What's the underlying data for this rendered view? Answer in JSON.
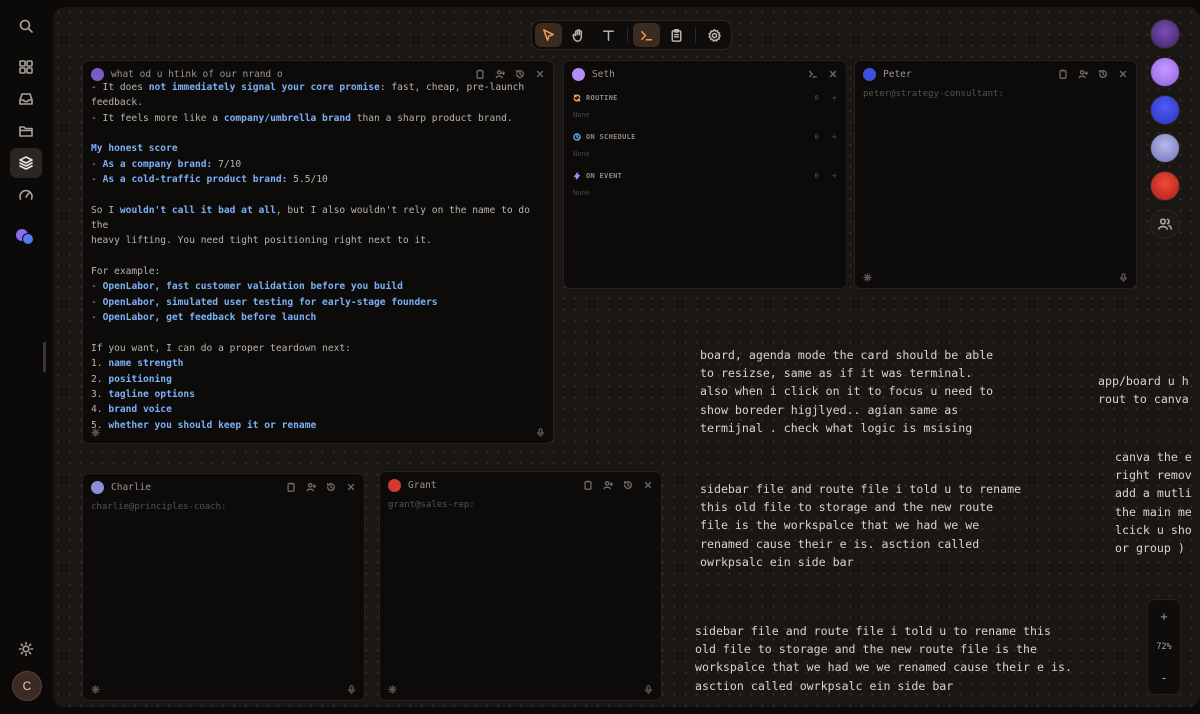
{
  "sidebar": {
    "items": [
      {
        "name": "search",
        "icon": "search-icon"
      },
      {
        "name": "dashboard",
        "icon": "grid-icon"
      },
      {
        "name": "inbox",
        "icon": "inbox-icon"
      },
      {
        "name": "folder",
        "icon": "folder-icon"
      },
      {
        "name": "layers",
        "icon": "layers-icon",
        "active": true
      },
      {
        "name": "gauge",
        "icon": "gauge-icon"
      }
    ],
    "settings_icon": "sun-icon",
    "user_initial": "C"
  },
  "toolbar": {
    "tools": [
      "select-tool",
      "hand-tool",
      "text-tool",
      "terminal-tool",
      "clipboard-tool",
      "settings-tool"
    ],
    "active_tools": [
      "select-tool",
      "terminal-tool"
    ]
  },
  "cards": {
    "chat": {
      "title": "what od u htink of our nrand o",
      "lines": [
        {
          "type": "mixed",
          "parts": [
            {
              "t": "- It does "
            },
            {
              "t": "not immediately signal your core promise",
              "b": true
            },
            {
              "t": ": fast, cheap, pre-launch"
            }
          ]
        },
        {
          "type": "plain",
          "text": "feedback."
        },
        {
          "type": "mixed",
          "parts": [
            {
              "t": "- It feels more like a "
            },
            {
              "t": "company/umbrella brand",
              "b": true
            },
            {
              "t": " than a sharp product brand."
            }
          ]
        },
        {
          "type": "gap"
        },
        {
          "type": "heading",
          "text": "My honest score"
        },
        {
          "type": "mixed",
          "parts": [
            {
              "t": "- "
            },
            {
              "t": "As a company brand:",
              "b": true
            },
            {
              "t": " 7/10"
            }
          ]
        },
        {
          "type": "mixed",
          "parts": [
            {
              "t": "- "
            },
            {
              "t": "As a cold-traffic product brand:",
              "b": true
            },
            {
              "t": " 5.5/10"
            }
          ]
        },
        {
          "type": "gap"
        },
        {
          "type": "mixed",
          "parts": [
            {
              "t": "So I "
            },
            {
              "t": "wouldn't call it bad at all",
              "b": true
            },
            {
              "t": ", but I also wouldn't rely on the name to do the"
            }
          ]
        },
        {
          "type": "plain",
          "text": "heavy lifting. You need tight positioning right next to it."
        },
        {
          "type": "gap"
        },
        {
          "type": "plain",
          "text": "For example:"
        },
        {
          "type": "mixed",
          "parts": [
            {
              "t": "- "
            },
            {
              "t": "OpenLabor, fast customer validation before you build",
              "b": true
            }
          ]
        },
        {
          "type": "mixed",
          "parts": [
            {
              "t": "- "
            },
            {
              "t": "OpenLabor, simulated user testing for early-stage founders",
              "b": true
            }
          ]
        },
        {
          "type": "mixed",
          "parts": [
            {
              "t": "- "
            },
            {
              "t": "OpenLabor, get feedback before launch",
              "b": true
            }
          ]
        },
        {
          "type": "gap"
        },
        {
          "type": "plain",
          "text": "If you want, I can do a proper teardown next:"
        },
        {
          "type": "mixed",
          "parts": [
            {
              "t": "1. "
            },
            {
              "t": "name strength",
              "b": true
            }
          ]
        },
        {
          "type": "mixed",
          "parts": [
            {
              "t": "2. "
            },
            {
              "t": "positioning",
              "b": true
            }
          ]
        },
        {
          "type": "mixed",
          "parts": [
            {
              "t": "3. "
            },
            {
              "t": "tagline options",
              "b": true
            }
          ]
        },
        {
          "type": "mixed",
          "parts": [
            {
              "t": "4. "
            },
            {
              "t": "brand voice",
              "b": true
            }
          ]
        },
        {
          "type": "mixed",
          "parts": [
            {
              "t": "5. "
            },
            {
              "t": "whether you should keep it or rename",
              "b": true
            }
          ]
        }
      ]
    },
    "seth": {
      "title": "Seth",
      "sections": [
        {
          "label": "ROUTINE",
          "count": "0",
          "empty": "None",
          "color": "#f59e5b"
        },
        {
          "label": "ON SCHEDULE",
          "count": "0",
          "empty": "None",
          "color": "#60a5fa"
        },
        {
          "label": "ON EVENT",
          "count": "0",
          "empty": "None",
          "color": "#a78bfa"
        }
      ]
    },
    "peter": {
      "title": "Peter",
      "prompt": "peter@strategy-consultant:"
    },
    "charlie": {
      "title": "Charlie",
      "prompt": "charlie@principles-coach:"
    },
    "grant": {
      "title": "Grant",
      "prompt": "grant@sales-rep:"
    }
  },
  "notes": {
    "note1": "board, agenda mode the card should be able\nto resizse, same as if it was terminal.\nalso when i click on it to focus u need to\nshow boreder higjlyed.. agian same as\ntermijnal . check what logic is msising",
    "note2": "sidebar file and route file i told u to rename\nthis old file to storage and the new route\nfile is the workspalce that we had we we\nrenamed cause their e is. asction called\nowrkpsalc ein side bar",
    "note3": "sidebar file and route file i told u to rename this\nold file to storage and the new route file is the\nworkspalce that we had we we renamed cause their e is.\nasction called owrkpsalc ein side bar",
    "note4": "app/board u h\nrout to canva",
    "note5": "canva the e\nright remov\nadd a mutli\nthe main me\nlcick u sho\nor group )"
  },
  "zoom": {
    "in": "+",
    "level": "72%",
    "out": "-"
  },
  "colors": {
    "accent": "#f59e5b",
    "link": "#7cb0f5",
    "canvas": "#1a1614"
  }
}
